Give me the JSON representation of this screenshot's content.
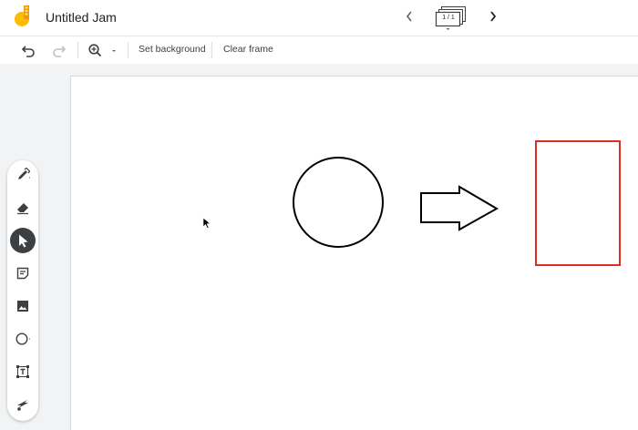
{
  "app": {
    "title": "Untitled Jam"
  },
  "frames": {
    "indicator": "1 / 1"
  },
  "toolbar": {
    "set_background_label": "Set background",
    "clear_frame_label": "Clear frame"
  },
  "tools": [
    {
      "name": "pen",
      "icon": "pen-icon",
      "active": false
    },
    {
      "name": "eraser",
      "icon": "eraser-icon",
      "active": false
    },
    {
      "name": "select",
      "icon": "cursor-icon",
      "active": true
    },
    {
      "name": "sticky-note",
      "icon": "sticky-note-icon",
      "active": false
    },
    {
      "name": "image",
      "icon": "image-icon",
      "active": false
    },
    {
      "name": "shape",
      "icon": "circle-icon",
      "active": false
    },
    {
      "name": "text-box",
      "icon": "text-box-icon",
      "active": false
    },
    {
      "name": "laser",
      "icon": "laser-icon",
      "active": false
    }
  ],
  "canvas_shapes": [
    {
      "type": "circle",
      "stroke": "#000000"
    },
    {
      "type": "arrow",
      "stroke": "#000000"
    },
    {
      "type": "rectangle",
      "stroke": "#d93025"
    }
  ],
  "colors": {
    "logo_yellow": "#fbbc04",
    "logo_orange": "#f29900",
    "active_tool": "#3c4043",
    "rectangle_stroke": "#d93025"
  }
}
